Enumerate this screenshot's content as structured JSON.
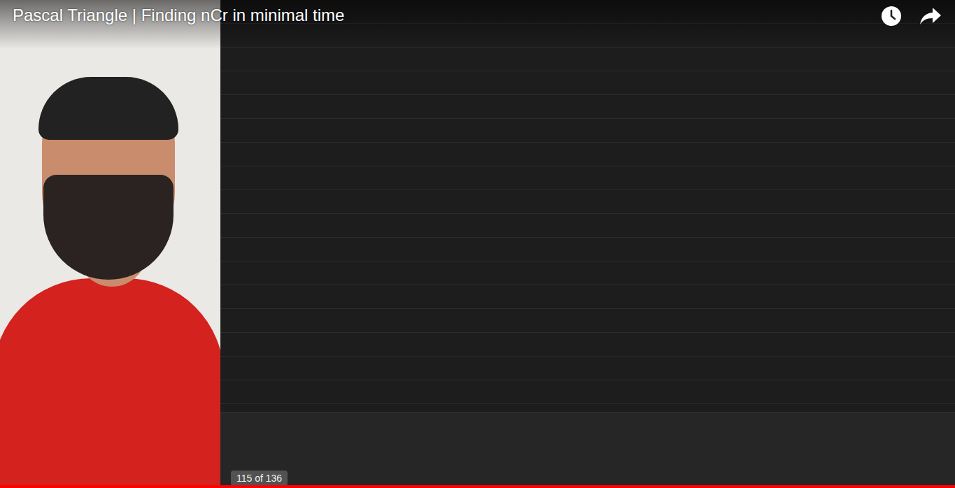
{
  "video": {
    "title": "Pascal Triangle | Finding nCr in minimal time",
    "playlist_position": "115 of 136",
    "progress": {
      "level": 1
    }
  }
}
